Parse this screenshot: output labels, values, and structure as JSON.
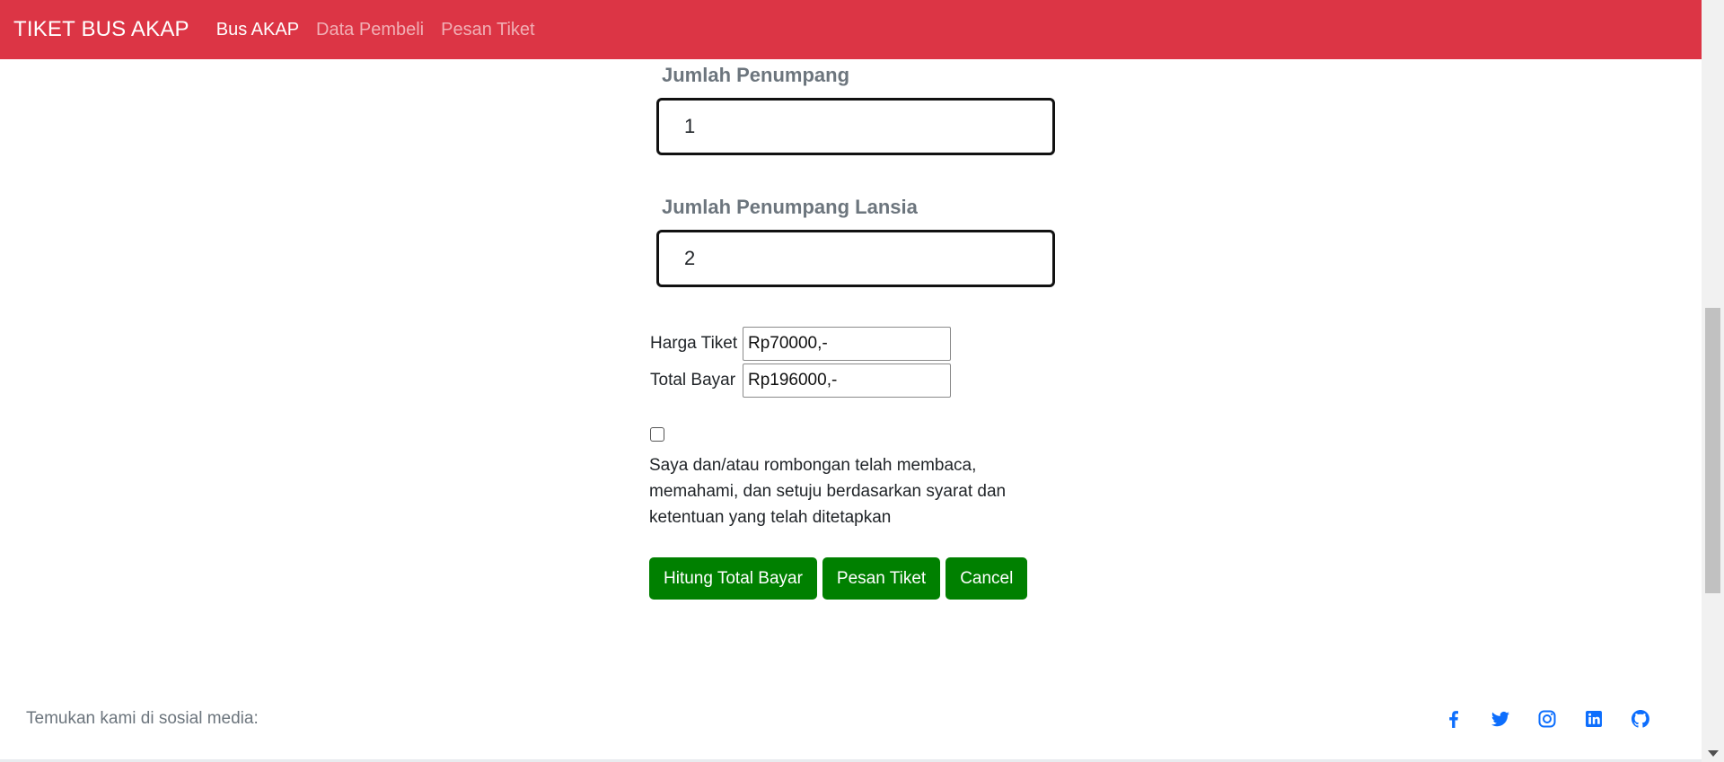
{
  "navbar": {
    "brand": "TIKET BUS AKAP",
    "links": [
      {
        "label": "Bus AKAP",
        "active": true
      },
      {
        "label": "Data Pembeli",
        "active": false
      },
      {
        "label": "Pesan Tiket",
        "active": false
      }
    ],
    "color": "#dc3545"
  },
  "form": {
    "passengers": {
      "label": "Jumlah Penumpang",
      "value": "1"
    },
    "elderly": {
      "label": "Jumlah Penumpang Lansia",
      "value": "2"
    },
    "ticket_price": {
      "label": "Harga Tiket",
      "value": "Rp70000,-"
    },
    "total_pay": {
      "label": "Total Bayar",
      "value": "Rp196000,-"
    },
    "agreement": {
      "checked": false,
      "text": "Saya dan/atau rombongan telah membaca, memahami, dan setuju berdasarkan syarat dan ketentuan yang telah ditetapkan"
    },
    "buttons": {
      "calculate": "Hitung Total Bayar",
      "order": "Pesan Tiket",
      "cancel": "Cancel"
    },
    "button_color": "#008000"
  },
  "footer": {
    "text": "Temukan kami di sosial media:",
    "social": [
      "facebook-icon",
      "twitter-icon",
      "instagram-icon",
      "linkedin-icon",
      "github-icon"
    ],
    "icon_color": "#0d6efd"
  }
}
